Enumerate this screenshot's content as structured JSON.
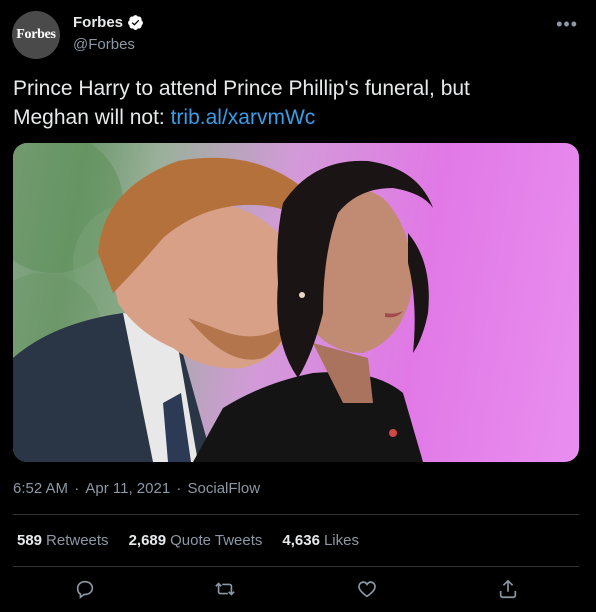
{
  "author": {
    "avatar_text": "Forbes",
    "display_name": "Forbes",
    "handle": "@Forbes",
    "verified_icon": "verified-badge-icon",
    "more_icon": "more-options-icon"
  },
  "tweet": {
    "text_line1": "Prince Harry to attend Prince Phillip's funeral, but",
    "text_line2": "Meghan will not: ",
    "link": "trib.al/xarvmWc",
    "time": "6:52 AM",
    "date": "Apr 11, 2021",
    "source": "SocialFlow",
    "sep": " · "
  },
  "stats": {
    "retweets_count": "589",
    "retweets_label": "Retweets",
    "quotes_count": "2,689",
    "quotes_label": "Quote Tweets",
    "likes_count": "4,636",
    "likes_label": "Likes"
  },
  "colors": {
    "background": "#000000",
    "link": "#3a9de8",
    "secondary_text": "#8b98a5",
    "verified": "#ffffff"
  },
  "actions": [
    "reply-icon",
    "retweet-icon",
    "like-icon",
    "share-icon"
  ]
}
